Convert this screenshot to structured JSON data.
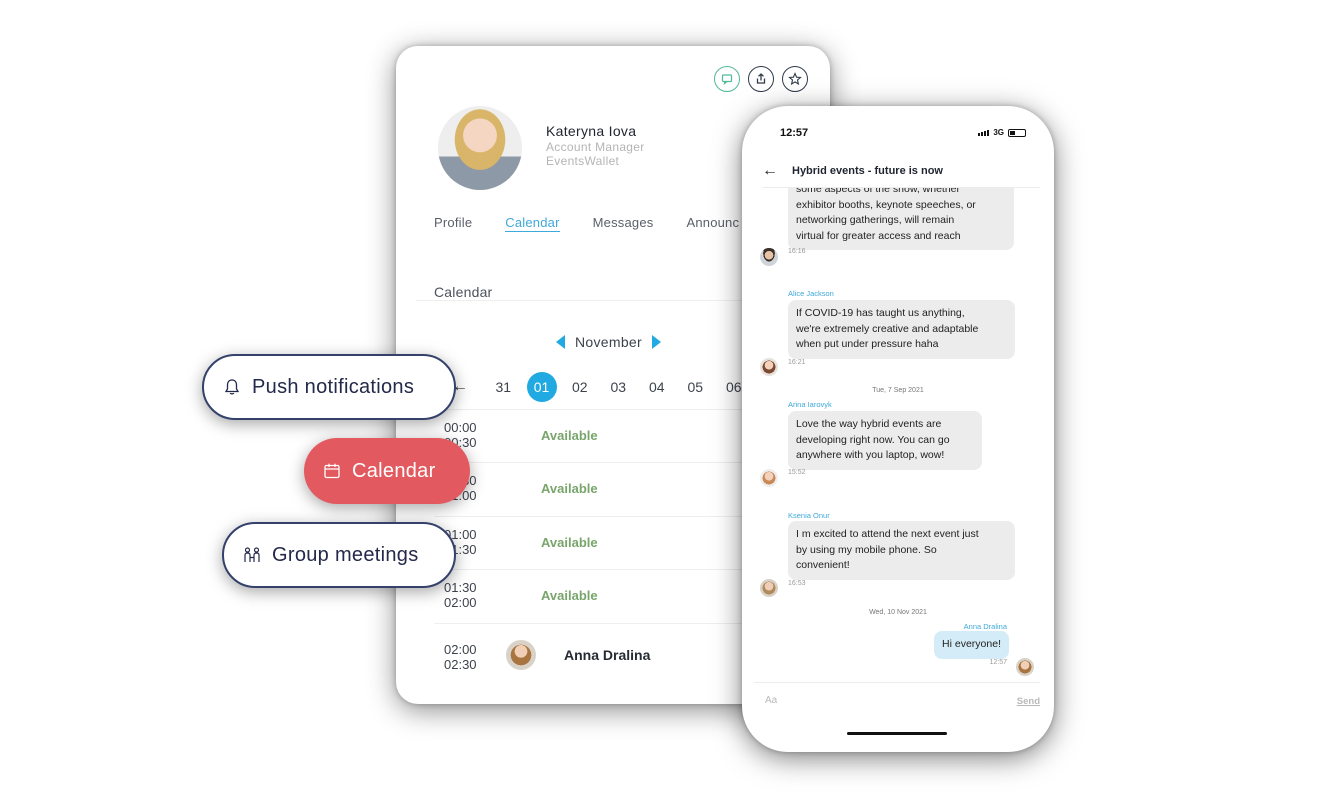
{
  "profile": {
    "name": "Kateryna Iova",
    "role": "Account Manager",
    "company": "EventsWallet"
  },
  "card_actions": [
    {
      "icon": "chat-icon"
    },
    {
      "icon": "share-icon"
    },
    {
      "icon": "star-icon"
    }
  ],
  "tabs": [
    "Profile",
    "Calendar",
    "Messages",
    "Announc"
  ],
  "active_tab": "Calendar",
  "calendar": {
    "title": "Calendar",
    "month": "November",
    "days": [
      "31",
      "01",
      "02",
      "03",
      "04",
      "05",
      "06"
    ],
    "selected_day": "01",
    "slots": [
      {
        "start": "00:00",
        "end": "00:30",
        "status": "Available"
      },
      {
        "start": "00:30",
        "end": "01:00",
        "status": "Available"
      },
      {
        "start": "01:00",
        "end": "01:30",
        "status": "Available"
      },
      {
        "start": "01:30",
        "end": "02:00",
        "status": "Available"
      },
      {
        "start": "02:00",
        "end": "02:30",
        "name": "Anna Dralina"
      }
    ]
  },
  "features": {
    "push": "Push notifications",
    "calendar": "Calendar",
    "group": "Group meetings"
  },
  "phone": {
    "time": "12:57",
    "network": "3G",
    "chat_title": "Hybrid events - future is now",
    "messages": [
      {
        "text_lines": [
          "some aspects of the show, whether",
          "exhibitor booths, keynote speeches, or",
          "networking gatherings, will remain",
          "virtual for greater access and reach"
        ],
        "time": "16:16"
      },
      {
        "sender": "Alice Jackson",
        "text_lines": [
          "If COVID-19 has taught us anything,",
          "we're extremely creative and adaptable",
          "when put under pressure haha"
        ],
        "time": "16:21"
      },
      {
        "date": "Tue, 7 Sep 2021"
      },
      {
        "sender": "Arina Iarovyk",
        "text_lines": [
          "Love the way hybrid events are",
          "developing right now. You can go",
          "anywhere with you laptop, wow!"
        ],
        "time": "15:52"
      },
      {
        "sender": "Ksenia Onur",
        "text_lines": [
          "I m excited to attend the next event just",
          "by using my mobile phone. So",
          "convenient!"
        ],
        "time": "16:53"
      },
      {
        "date": "Wed, 10 Nov 2021"
      },
      {
        "sender": "Anna Dralina",
        "text_lines": [
          "Hi everyone!"
        ],
        "time": "12:57"
      }
    ],
    "input_placeholder": "Aa",
    "send_label": "Send"
  },
  "colors": {
    "accent": "#21a9e1",
    "available": "#79a56b",
    "pill_red": "#e25a5f",
    "pill_border": "#33416b"
  }
}
